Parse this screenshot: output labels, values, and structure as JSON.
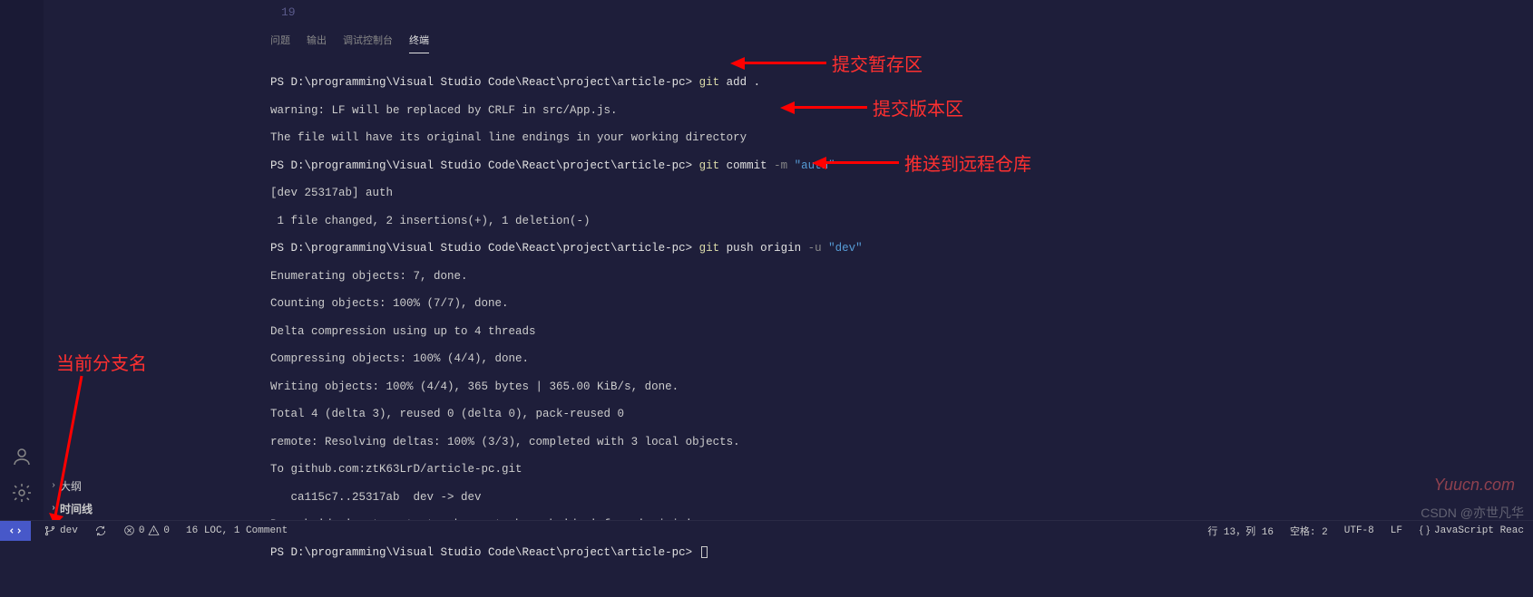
{
  "editor": {
    "line_number": "19"
  },
  "panel": {
    "tabs": {
      "problems": "问题",
      "output": "输出",
      "debug": "调试控制台",
      "terminal": "终端"
    }
  },
  "terminal": {
    "prompt_path": "PS D:\\programming\\Visual Studio Code\\React\\project\\article-pc>",
    "cmd1_git": "git",
    "cmd1_rest": " add .",
    "warn1": "warning: LF will be replaced by CRLF in src/App.js.",
    "warn2": "The file will have its original line endings in your working directory",
    "cmd2_git": "git",
    "cmd2_sub": " commit ",
    "cmd2_flag": "-m",
    "cmd2_str": " \"auth\"",
    "out2a": "[dev 25317ab] auth",
    "out2b": " 1 file changed, 2 insertions(+), 1 deletion(-)",
    "cmd3_git": "git",
    "cmd3_sub": " push origin ",
    "cmd3_flag": "-u",
    "cmd3_str": " \"dev\"",
    "out3a": "Enumerating objects: 7, done.",
    "out3b": "Counting objects: 100% (7/7), done.",
    "out3c": "Delta compression using up to 4 threads",
    "out3d": "Compressing objects: 100% (4/4), done.",
    "out3e": "Writing objects: 100% (4/4), 365 bytes | 365.00 KiB/s, done.",
    "out3f": "Total 4 (delta 3), reused 0 (delta 0), pack-reused 0",
    "out3g": "remote: Resolving deltas: 100% (3/3), completed with 3 local objects.",
    "out3h": "To github.com:ztK63LrD/article-pc.git",
    "out3i": "   ca115c7..25317ab  dev -> dev",
    "out3j": "Branch 'dev' set up to track remote branch 'dev' from 'origin'."
  },
  "annotations": {
    "a1": "提交暂存区",
    "a2": "提交版本区",
    "a3": "推送到远程仓库",
    "a4": "当前分支名"
  },
  "sidebar": {
    "outline": "大纲",
    "timeline": "时间线"
  },
  "statusbar": {
    "branch": "dev",
    "sync": "",
    "errors": "0",
    "warnings": "0",
    "loc": "16 LOC, 1 Comment",
    "ln_col": "行 13，列 16",
    "spaces": "空格: 2",
    "encoding": "UTF-8",
    "eol": "LF",
    "lang": "JavaScript Reac"
  },
  "watermarks": {
    "yuucn": "Yuucn.com",
    "csdn": "CSDN @亦世凡华"
  }
}
